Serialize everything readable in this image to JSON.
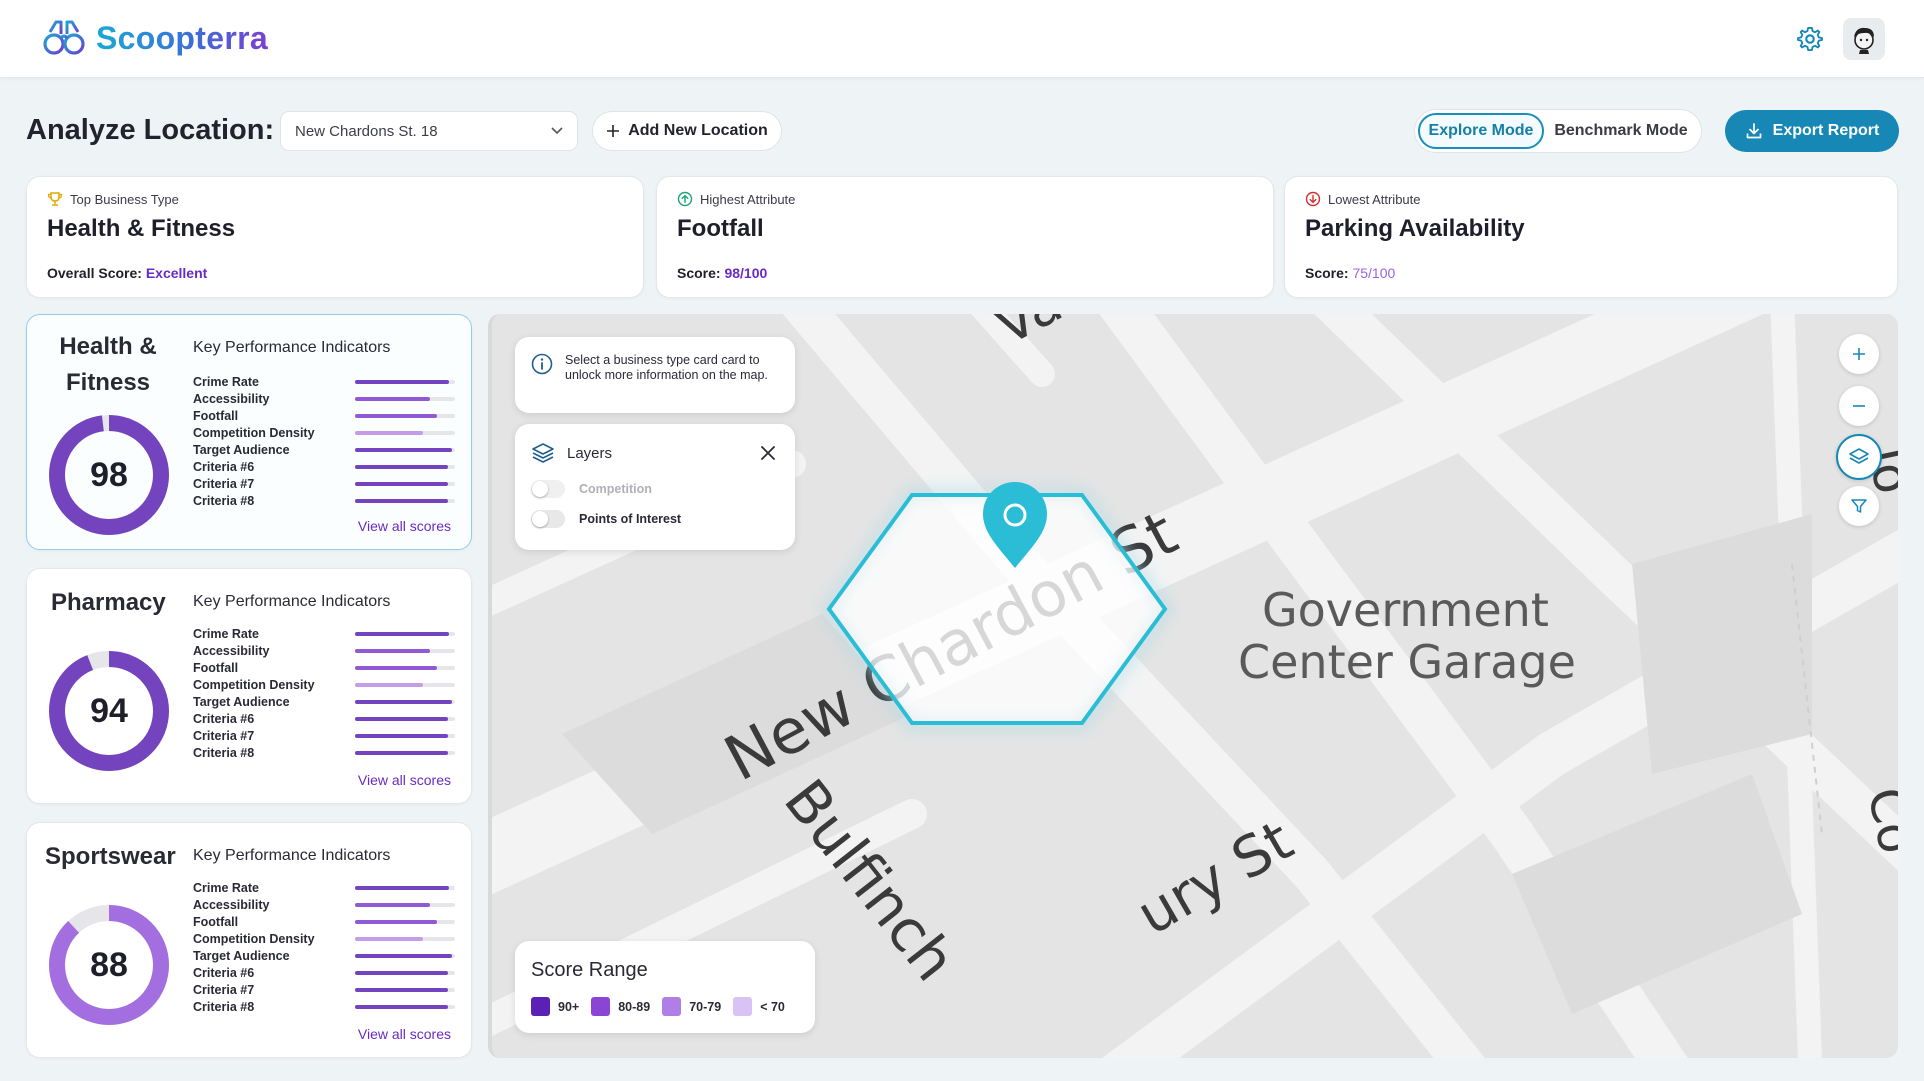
{
  "app": {
    "name": "Scoopterra",
    "brand_icon": "binoculars-icon"
  },
  "header": {
    "settings_icon": "gear-icon",
    "avatar_icon": "user-avatar"
  },
  "analyze": {
    "title": "Analyze Location:",
    "location_value": "New Chardons St. 18",
    "add_location_label": "Add New Location",
    "mode_explore": "Explore Mode",
    "mode_benchmark": "Benchmark Mode",
    "active_mode": "Explore Mode",
    "export_label": "Export Report"
  },
  "summary": {
    "top": {
      "label": "Top Business Type",
      "value": "Health & Fitness",
      "score_label": "Overall Score:",
      "score_value": "Excellent"
    },
    "highest": {
      "label": "Highest Attribute",
      "value": "Footfall",
      "score_label": "Score:",
      "score_value": "98/100"
    },
    "lowest": {
      "label": "Lowest Attribute",
      "value": "Parking Availability",
      "score_label": "Score:",
      "score_value": "75/100"
    }
  },
  "business_cards": [
    {
      "title": "Health & Fitness",
      "score": "98",
      "score_pct": 0.98,
      "kpi_title": "Key Performance Indicators",
      "view_all": "View all scores",
      "color": "#7344bd",
      "kpis": [
        {
          "name": "Crime Rate",
          "value": 0.94,
          "color": "#7344bd"
        },
        {
          "name": "Accessibility",
          "value": 0.75,
          "color": "#9159d3"
        },
        {
          "name": "Footfall",
          "value": 0.82,
          "color": "#9159d3"
        },
        {
          "name": "Competition Density",
          "value": 0.68,
          "color": "#c49ce8"
        },
        {
          "name": "Target Audience",
          "value": 0.97,
          "color": "#7344bd"
        },
        {
          "name": "Criteria #6",
          "value": 0.93,
          "color": "#7344bd"
        },
        {
          "name": "Criteria #7",
          "value": 0.93,
          "color": "#7344bd"
        },
        {
          "name": "Criteria #8",
          "value": 0.93,
          "color": "#7344bd"
        }
      ]
    },
    {
      "title": "Pharmacy",
      "score": "94",
      "score_pct": 0.94,
      "kpi_title": "Key Performance Indicators",
      "view_all": "View all scores",
      "color": "#7344bd",
      "kpis": [
        {
          "name": "Crime Rate",
          "value": 0.94,
          "color": "#7344bd"
        },
        {
          "name": "Accessibility",
          "value": 0.75,
          "color": "#9159d3"
        },
        {
          "name": "Footfall",
          "value": 0.82,
          "color": "#9159d3"
        },
        {
          "name": "Competition Density",
          "value": 0.68,
          "color": "#c49ce8"
        },
        {
          "name": "Target Audience",
          "value": 0.97,
          "color": "#7344bd"
        },
        {
          "name": "Criteria #6",
          "value": 0.93,
          "color": "#7344bd"
        },
        {
          "name": "Criteria #7",
          "value": 0.93,
          "color": "#7344bd"
        },
        {
          "name": "Criteria #8",
          "value": 0.93,
          "color": "#7344bd"
        }
      ]
    },
    {
      "title": "Sportswear",
      "score": "88",
      "score_pct": 0.88,
      "kpi_title": "Key Performance Indicators",
      "view_all": "View all scores",
      "color": "#a36fe0",
      "kpis": [
        {
          "name": "Crime Rate",
          "value": 0.94,
          "color": "#7344bd"
        },
        {
          "name": "Accessibility",
          "value": 0.75,
          "color": "#9159d3"
        },
        {
          "name": "Footfall",
          "value": 0.82,
          "color": "#9159d3"
        },
        {
          "name": "Competition Density",
          "value": 0.68,
          "color": "#c49ce8"
        },
        {
          "name": "Target Audience",
          "value": 0.97,
          "color": "#7344bd"
        },
        {
          "name": "Criteria #6",
          "value": 0.93,
          "color": "#7344bd"
        },
        {
          "name": "Criteria #7",
          "value": 0.93,
          "color": "#7344bd"
        },
        {
          "name": "Criteria #8",
          "value": 0.93,
          "color": "#7344bd"
        }
      ]
    }
  ],
  "map": {
    "info_text": "Select a  business type card card to unlock more information on the map.",
    "layers_title": "Layers",
    "layer_competition": "Competition",
    "layer_poi": "Points of Interest",
    "score_range_title": "Score Range",
    "legend": [
      {
        "label": "90+",
        "color": "#5b21b6"
      },
      {
        "label": "80-89",
        "color": "#8b45d6"
      },
      {
        "label": "70-79",
        "color": "#b07fe6"
      },
      {
        "label": "< 70",
        "color": "#d9c2f6"
      }
    ],
    "labels": {
      "va": "Va",
      "new_chardon": "New Chardon St",
      "government": "Government",
      "center_garage": "Center Garage",
      "bulfinch": "Bulfinch",
      "ury_st": "ury St",
      "jo": "Jo",
      "co": "Co"
    },
    "accent": "#2bbdd6"
  }
}
